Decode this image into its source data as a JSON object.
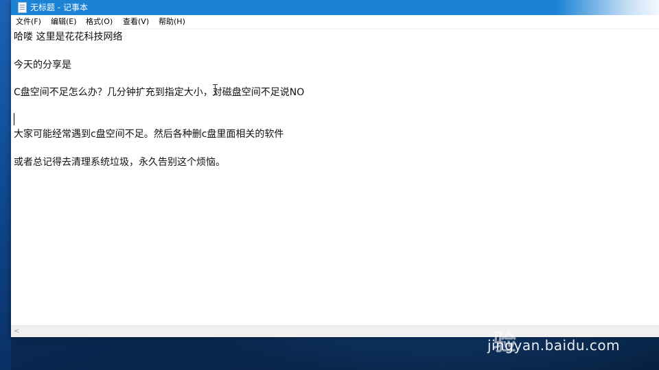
{
  "window": {
    "title": "无标题 - 记事本"
  },
  "menu": [
    {
      "label": "文件(F)"
    },
    {
      "label": "编辑(E)"
    },
    {
      "label": "格式(O)"
    },
    {
      "label": "查看(V)"
    },
    {
      "label": "帮助(H)"
    }
  ],
  "editor": {
    "lines": [
      "哈喽 这里是花花科技网络",
      "今天的分享是",
      "C盘空间不足怎么办？几分钟扩充到指定大小，对磁盘空间不足说NO",
      "大家可能经常遇到c盘空间不足。然后各种删c盘里面相关的软件",
      "或者总记得去清理系统垃圾，永久告别这个烦恼。"
    ]
  },
  "scrollbar": {
    "left_arrow": "<"
  },
  "watermark": {
    "logo_text": "Bai du 经验",
    "url": "jingyan.baidu.com"
  },
  "colors": {
    "titlebar": "#1b82d6",
    "desktop": "#0a2a55",
    "text": "#111111"
  }
}
